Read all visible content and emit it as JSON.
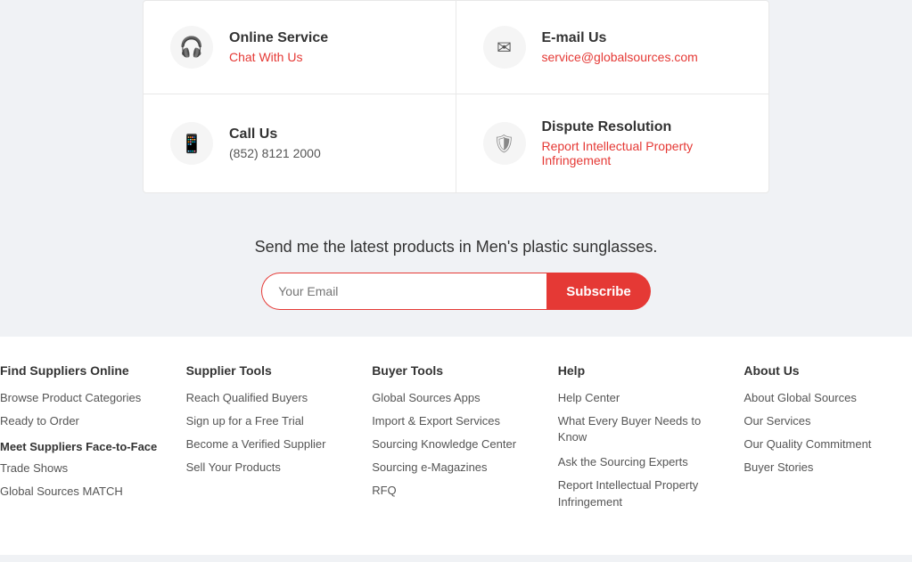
{
  "contact": {
    "items": [
      {
        "id": "online-service",
        "icon": "headset",
        "title": "Online Service",
        "link_text": "Chat With Us",
        "link_href": "#"
      },
      {
        "id": "email-us",
        "icon": "email",
        "title": "E-mail Us",
        "value": "service@globalsources.com",
        "link_href": "mailto:service@globalsources.com"
      },
      {
        "id": "call-us",
        "icon": "phone",
        "title": "Call Us",
        "value": "(852) 8121 2000"
      },
      {
        "id": "dispute-resolution",
        "icon": "shield",
        "title": "Dispute Resolution",
        "link_text": "Report Intellectual Property Infringement",
        "link_href": "#"
      }
    ]
  },
  "newsletter": {
    "heading": "Send me the latest products in Men's plastic sunglasses.",
    "input_placeholder": "Your Email",
    "button_label": "Subscribe"
  },
  "footer": {
    "columns": [
      {
        "id": "find-suppliers",
        "heading": "Find Suppliers Online",
        "items": [
          {
            "label": "Browse Product Categories",
            "href": "#"
          },
          {
            "label": "Ready to Order",
            "href": "#"
          }
        ],
        "sub_sections": [
          {
            "heading": "Meet Suppliers Face-to-Face",
            "items": [
              {
                "label": "Trade Shows",
                "href": "#"
              },
              {
                "label": "Global Sources MATCH",
                "href": "#"
              }
            ]
          }
        ]
      },
      {
        "id": "supplier-tools",
        "heading": "Supplier Tools",
        "items": [
          {
            "label": "Reach Qualified Buyers",
            "href": "#"
          },
          {
            "label": "Sign up for a Free Trial",
            "href": "#"
          },
          {
            "label": "Become a Verified Supplier",
            "href": "#"
          },
          {
            "label": "Sell Your Products",
            "href": "#"
          }
        ]
      },
      {
        "id": "buyer-tools",
        "heading": "Buyer Tools",
        "items": [
          {
            "label": "Global Sources Apps",
            "href": "#"
          },
          {
            "label": "Import & Export Services",
            "href": "#"
          },
          {
            "label": "Sourcing Knowledge Center",
            "href": "#"
          },
          {
            "label": "Sourcing e-Magazines",
            "href": "#"
          },
          {
            "label": "RFQ",
            "href": "#"
          }
        ]
      },
      {
        "id": "help",
        "heading": "Help",
        "items": [
          {
            "label": "Help Center",
            "href": "#"
          },
          {
            "label": "What Every Buyer Needs to Know",
            "href": "#"
          },
          {
            "label": "Ask the Sourcing Experts",
            "href": "#"
          },
          {
            "label": "Report Intellectual Property Infringement",
            "href": "#"
          }
        ]
      },
      {
        "id": "about-us",
        "heading": "About Us",
        "items": [
          {
            "label": "About Global Sources",
            "href": "#"
          },
          {
            "label": "Our Services",
            "href": "#"
          },
          {
            "label": "Our Quality Commitment",
            "href": "#"
          },
          {
            "label": "Buyer Stories",
            "href": "#"
          }
        ]
      }
    ]
  }
}
